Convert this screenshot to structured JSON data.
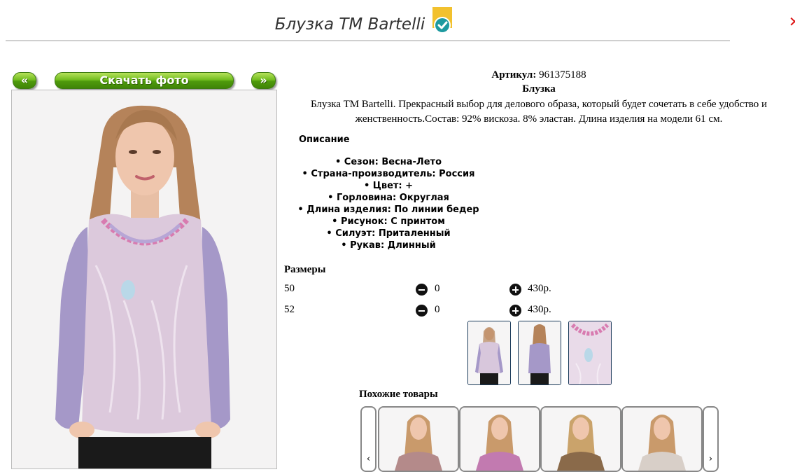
{
  "product": {
    "title": "Блузка ТМ Bartelli",
    "article_label": "Артикул:",
    "article_value": "961375188",
    "category": "Блузка",
    "text": "Блузка ТМ Bartelli. Прекрасный выбор для делового образа, который будет сочетать в себе удобство и женственность.Состав: 92% вискоза. 8% эластан. Длина изделия на модели 61 см."
  },
  "nav": {
    "prev": "«",
    "download": "Скачать фото",
    "next": "»"
  },
  "description": {
    "heading": "Описание",
    "items": [
      "• Сезон: Весна-Лето",
      "• Страна-производитель: Россия",
      "• Цвет: +",
      "• Горловина: Округлая",
      "• Длина изделия: По линии бедер",
      "• Рисунок: С принтом",
      "• Силуэт: Приталенный",
      "• Рукав: Длинный"
    ]
  },
  "sizes": {
    "heading": "Размеры",
    "rows": [
      {
        "size": "50",
        "qty": "0",
        "price": "430р."
      },
      {
        "size": "52",
        "qty": "0",
        "price": "430р."
      }
    ]
  },
  "similar": {
    "heading": "Похожие товары",
    "prev": "‹",
    "next": "›"
  },
  "icons": {
    "check": "check-badge-icon",
    "minus": "minus-circle-icon",
    "plus": "plus-circle-icon"
  },
  "colors": {
    "button_green": "#72bd20",
    "badge_yellow": "#f2c12e",
    "badge_teal": "#1e9aa0"
  }
}
